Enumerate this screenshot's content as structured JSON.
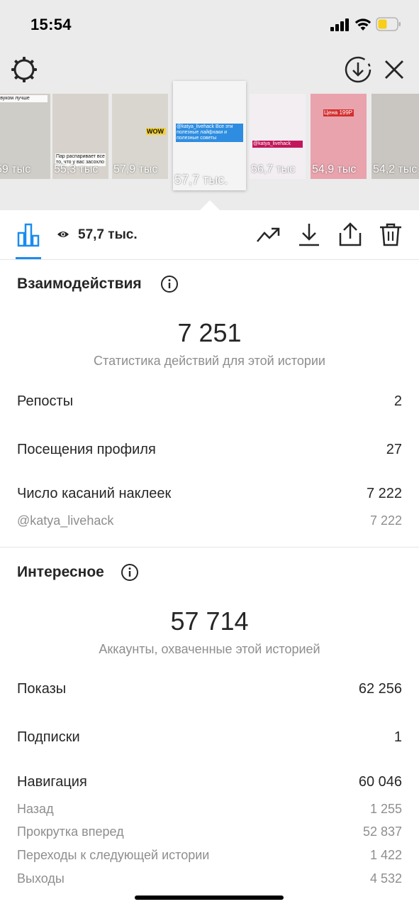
{
  "status": {
    "time": "15:54"
  },
  "colors": {
    "accent": "#1a8cf0",
    "battery": "#f7ce1a"
  },
  "header_icons": {
    "settings": "gear-icon",
    "save": "download-circle-icon",
    "close": "close-icon"
  },
  "thumbnails": [
    {
      "views": "59 тыс",
      "caption": "звуком лучше",
      "bg": "#cfcdc7"
    },
    {
      "views": "55,3 тыс",
      "caption": "Пар распаривает все то, что у вас засохло",
      "bg": "#d7d2cc"
    },
    {
      "views": "57,9 тыс",
      "caption": "WOW",
      "bg": "#d9d6d0"
    },
    {
      "views": "57,7 тыс.",
      "caption": "@katya_livehack Все эти полезные лайфхаки и полезные советы",
      "bg": "#f4f4f4"
    },
    {
      "views": "56,7 тыс",
      "caption": "@katya_livehack",
      "bg": "#f2eef2"
    },
    {
      "views": "54,9 тыс",
      "caption": "Цена 199Р",
      "bg": "#e9a3ad"
    },
    {
      "views": "54,2 тыс",
      "caption": "",
      "bg": "#c9c5c1"
    }
  ],
  "toolbar": {
    "views": "57,7 тыс.",
    "icons": [
      "bar-chart-icon",
      "eye-icon",
      "trending-icon",
      "download-icon",
      "share-icon",
      "trash-icon"
    ]
  },
  "interactions": {
    "title": "Взаимодействия",
    "total": "7 251",
    "subtitle": "Статистика действий для этой истории",
    "rows": [
      {
        "label": "Репосты",
        "value": "2"
      },
      {
        "label": "Посещения профиля",
        "value": "27"
      },
      {
        "label": "Число касаний наклеек",
        "value": "7 222"
      }
    ],
    "sub_rows": [
      {
        "label": "@katya_livehack",
        "value": "7 222"
      }
    ]
  },
  "discovery": {
    "title": "Интересное",
    "total": "57 714",
    "subtitle": "Аккаунты, охваченные этой историей",
    "rows": [
      {
        "label": "Показы",
        "value": "62 256"
      },
      {
        "label": "Подписки",
        "value": "1"
      },
      {
        "label": "Навигация",
        "value": "60 046"
      }
    ],
    "sub_rows": [
      {
        "label": "Назад",
        "value": "1 255"
      },
      {
        "label": "Прокрутка вперед",
        "value": "52 837"
      },
      {
        "label": "Переходы к следующей истории",
        "value": "1 422"
      },
      {
        "label": "Выходы",
        "value": "4 532"
      }
    ]
  }
}
